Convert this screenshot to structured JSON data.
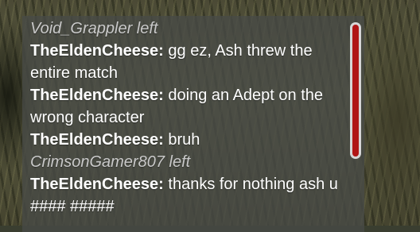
{
  "chat": {
    "lines": [
      {
        "type": "system",
        "text": "Void_Grappler left"
      },
      {
        "type": "message",
        "user": "TheEldenCheese:",
        "text": "gg ez, Ash threw the entire match"
      },
      {
        "type": "message",
        "user": "TheEldenCheese:",
        "text": "doing an Adept on the wrong character"
      },
      {
        "type": "message",
        "user": "TheEldenCheese:",
        "text": "bruh"
      },
      {
        "type": "system",
        "text": "CrimsonGamer807 left"
      },
      {
        "type": "message",
        "user": "TheEldenCheese:",
        "text": "thanks for nothing ash u #### #####"
      }
    ]
  },
  "colors": {
    "scroll_thumb": "#b01515",
    "scroll_track": "#d6d6d6",
    "system_text": "#c9c9c9",
    "message_text": "#ffffff"
  }
}
